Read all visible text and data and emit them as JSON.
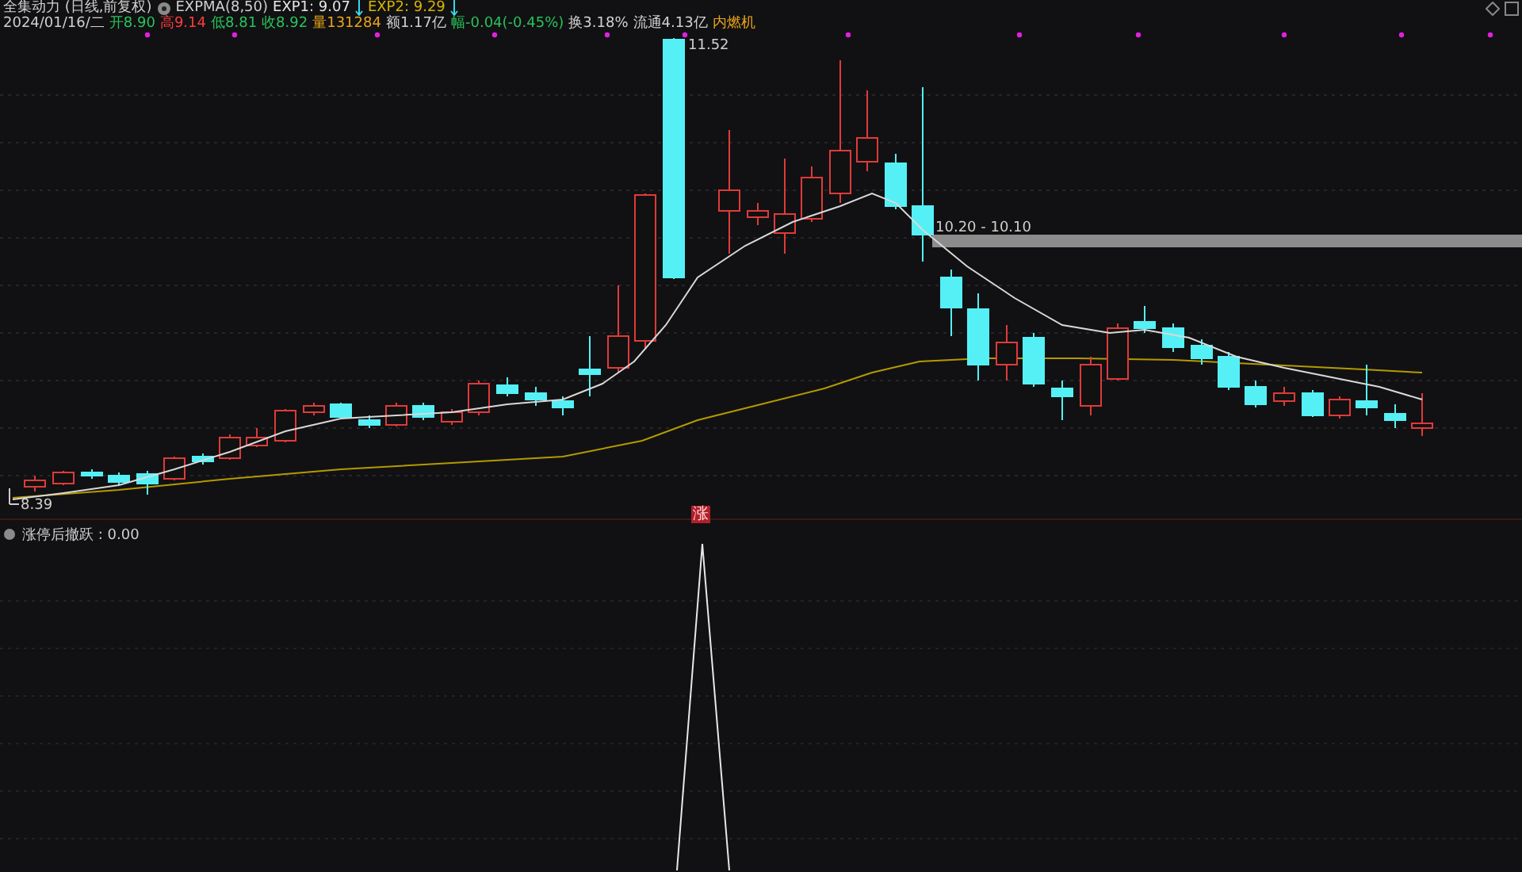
{
  "header": {
    "title": "全集动力 (日线,前复权)",
    "indicator": "EXPMA(8,50)",
    "values": [
      {
        "text": "EXP1: 9.07",
        "color": "#e6e6e6"
      },
      {
        "text": "EXP2: 9.29",
        "color": "#d8b400"
      }
    ]
  },
  "quote": {
    "date": "2024/01/16/二",
    "fields": [
      {
        "text": "开8.90",
        "color": "#29c25a"
      },
      {
        "text": "高9.14",
        "color": "#ff3b3b"
      },
      {
        "text": "低8.81",
        "color": "#29c25a"
      },
      {
        "text": "收8.92",
        "color": "#29c25a"
      },
      {
        "text": "量131284",
        "color": "#e8a318"
      },
      {
        "text": "额1.17亿",
        "color": "#d0d0d0"
      },
      {
        "text": "幅-0.04(-0.45%)",
        "color": "#29c25a"
      },
      {
        "text": "换3.18%",
        "color": "#d0d0d0"
      },
      {
        "text": "流通4.13亿",
        "color": "#d0d0d0"
      },
      {
        "text": "内燃机",
        "color": "#e8a318"
      }
    ]
  },
  "chart": {
    "high_label": "11.52",
    "low_label": "8.39",
    "range_label": "10.20 - 10.10",
    "signal_marker": "涨"
  },
  "lower_panel": {
    "label": "涨停后撤跃 : 0.00"
  }
}
